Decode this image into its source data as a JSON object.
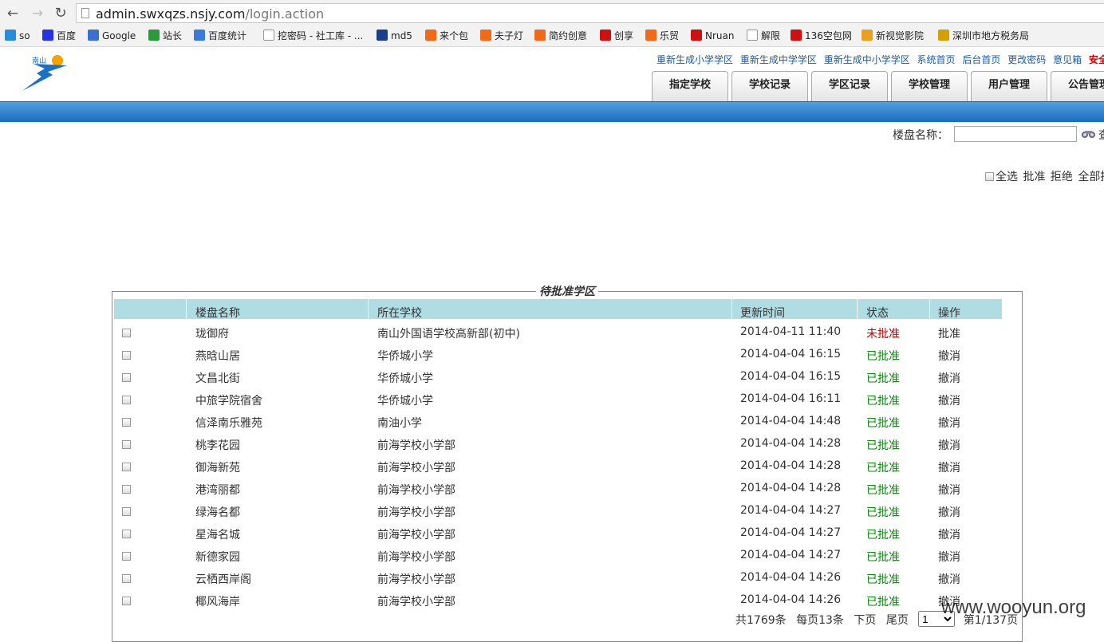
{
  "browser": {
    "url_host": "admin.swxqzs.nsjy.com",
    "url_path": "/login.action",
    "bookmarks": [
      {
        "label": "so",
        "color": "#2a8bd8",
        "icon": "search-icon"
      },
      {
        "label": "百度",
        "color": "#2932e1",
        "icon": "baidu-paw-icon"
      },
      {
        "label": "Google",
        "color": "#3b6fd0",
        "icon": "google-bird-icon"
      },
      {
        "label": "站长",
        "color": "#2a9a3a",
        "icon": "page-icon"
      },
      {
        "label": "百度统计",
        "color": "#3a7ad8",
        "icon": "chart-icon"
      },
      {
        "label": "挖密码 - 社工库 - ...",
        "color": "#ffffff",
        "icon": "page-icon"
      },
      {
        "label": "md5",
        "color": "#1a3e8c",
        "icon": "grid-icon"
      },
      {
        "label": "来个包",
        "color": "#f06a1a",
        "icon": "taobao-icon"
      },
      {
        "label": "夫子灯",
        "color": "#f06a1a",
        "icon": "taobao-icon"
      },
      {
        "label": "简约创意",
        "color": "#f06a1a",
        "icon": "taobao-icon"
      },
      {
        "label": "创享",
        "color": "#cc1111",
        "icon": "t-icon"
      },
      {
        "label": "乐贸",
        "color": "#f06a1a",
        "icon": "taobao-icon"
      },
      {
        "label": "Nruan",
        "color": "#cc1111",
        "icon": "n-icon"
      },
      {
        "label": "解限",
        "color": "#ffffff",
        "icon": "page-icon"
      },
      {
        "label": "136空包网",
        "color": "#cc1111",
        "icon": "dan-icon"
      },
      {
        "label": "新视觉影院",
        "color": "#e8a020",
        "icon": "movie-icon"
      },
      {
        "label": "深圳市地方税务局",
        "color": "#d4a000",
        "icon": "tax-icon"
      }
    ]
  },
  "header": {
    "top_links": [
      "重新生成小学学区",
      "重新生成中学学区",
      "重新生成中小学学区",
      "系统首页",
      "后台首页",
      "更改密码",
      "意见箱"
    ],
    "top_link_exit": "安全",
    "tabs": [
      "指定学校",
      "学校记录",
      "学区记录",
      "学校管理",
      "用户管理",
      "公告管理"
    ]
  },
  "search": {
    "label": "楼盘名称：",
    "value": "",
    "button": "查"
  },
  "bulk": {
    "select_all": "全选",
    "approve": "批准",
    "reject": "拒绝",
    "all": "全部拒"
  },
  "table": {
    "title": "待批准学区",
    "columns": [
      "楼盘名称",
      "所在学校",
      "更新时间",
      "状态",
      "操作"
    ],
    "rows": [
      {
        "estate": "珑御府",
        "school": "南山外国语学校高新部(初中)",
        "time": "2014-04-11 11:40",
        "status": "未批准",
        "action": "批准",
        "approved": false
      },
      {
        "estate": "燕晗山居",
        "school": "华侨城小学",
        "time": "2014-04-04 16:15",
        "status": "已批准",
        "action": "撤消",
        "approved": true
      },
      {
        "estate": "文昌北街",
        "school": "华侨城小学",
        "time": "2014-04-04 16:15",
        "status": "已批准",
        "action": "撤消",
        "approved": true
      },
      {
        "estate": "中旅学院宿舍",
        "school": "华侨城小学",
        "time": "2014-04-04 16:11",
        "status": "已批准",
        "action": "撤消",
        "approved": true
      },
      {
        "estate": "信泽南乐雅苑",
        "school": "南油小学",
        "time": "2014-04-04 14:48",
        "status": "已批准",
        "action": "撤消",
        "approved": true
      },
      {
        "estate": "桃李花园",
        "school": "前海学校小学部",
        "time": "2014-04-04 14:28",
        "status": "已批准",
        "action": "撤消",
        "approved": true
      },
      {
        "estate": "御海新苑",
        "school": "前海学校小学部",
        "time": "2014-04-04 14:28",
        "status": "已批准",
        "action": "撤消",
        "approved": true
      },
      {
        "estate": "港湾丽都",
        "school": "前海学校小学部",
        "time": "2014-04-04 14:28",
        "status": "已批准",
        "action": "撤消",
        "approved": true
      },
      {
        "estate": "绿海名都",
        "school": "前海学校小学部",
        "time": "2014-04-04 14:27",
        "status": "已批准",
        "action": "撤消",
        "approved": true
      },
      {
        "estate": "星海名城",
        "school": "前海学校小学部",
        "time": "2014-04-04 14:27",
        "status": "已批准",
        "action": "撤消",
        "approved": true
      },
      {
        "estate": "新德家园",
        "school": "前海学校小学部",
        "time": "2014-04-04 14:27",
        "status": "已批准",
        "action": "撤消",
        "approved": true
      },
      {
        "estate": "云栖西岸阁",
        "school": "前海学校小学部",
        "time": "2014-04-04 14:26",
        "status": "已批准",
        "action": "撤消",
        "approved": true
      },
      {
        "estate": "椰风海岸",
        "school": "前海学校小学部",
        "time": "2014-04-04 14:26",
        "status": "已批准",
        "action": "撤消",
        "approved": true
      }
    ]
  },
  "pager": {
    "total": "共1769条",
    "per_page": "每页13条",
    "next": "下页",
    "last": "尾页",
    "page_select": "1",
    "page_info": "第1/137页"
  },
  "watermark": "www.wooyun.org",
  "colors": {
    "approved": "#0a8a0a",
    "pending": "#cc0000",
    "header_bar": "#1a6dbd",
    "table_header": "#b0dce4"
  }
}
